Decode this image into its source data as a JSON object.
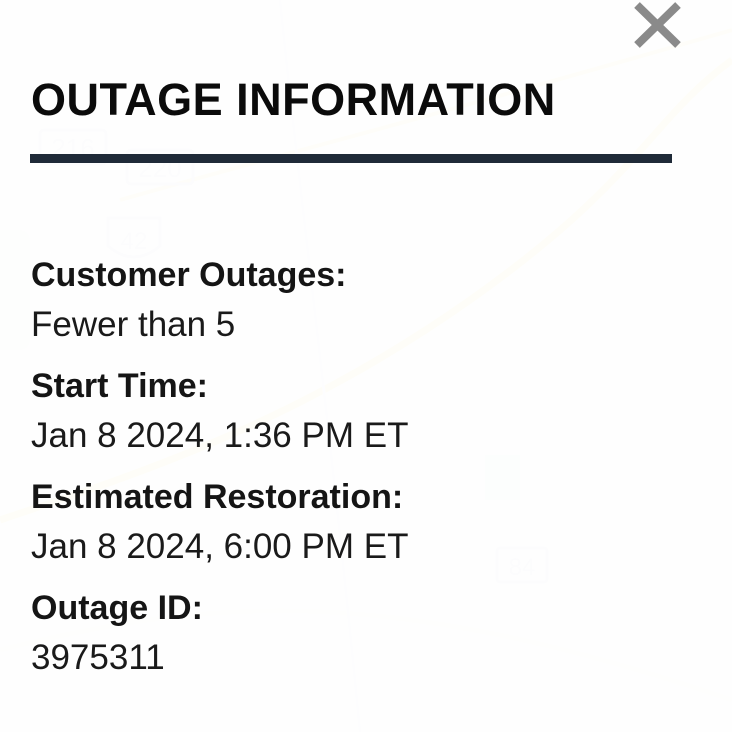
{
  "popup": {
    "title": "OUTAGE INFORMATION",
    "close_icon": "close-icon",
    "accent_color": "#1f2a38",
    "fields": [
      {
        "label": "Customer Outages:",
        "value": "Fewer than 5"
      },
      {
        "label": "Start Time:",
        "value": "Jan 8 2024, 1:36 PM ET"
      },
      {
        "label": "Estimated Restoration:",
        "value": "Jan 8 2024, 6:00 PM ET"
      },
      {
        "label": "Outage ID:",
        "value": "3975311"
      }
    ]
  },
  "map": {
    "route_shields": [
      "216",
      "220",
      "42",
      "84"
    ]
  }
}
